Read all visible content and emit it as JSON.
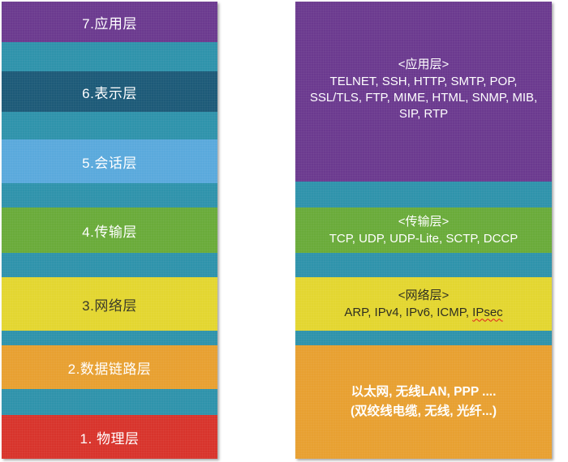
{
  "colors": {
    "teal": "#2f93ab",
    "purple": "#6b3a8f",
    "navy": "#1d5a78",
    "light_blue": "#5aa9dc",
    "green": "#6aab3a",
    "yellow": "#e3d630",
    "orange": "#e8a031",
    "red": "#d8342c"
  },
  "osi_layers": [
    {
      "label": "7.应用层",
      "color": "purple"
    },
    {
      "label": "6.表示层",
      "color": "navy"
    },
    {
      "label": "5.会话层",
      "color": "light_blue"
    },
    {
      "label": "4.传输层",
      "color": "green"
    },
    {
      "label": "3.网络层",
      "color": "yellow"
    },
    {
      "label": "2.数据链路层",
      "color": "orange"
    },
    {
      "label": "1. 物理层",
      "color": "red"
    }
  ],
  "tcpip": {
    "application": {
      "header": "<应用层>",
      "protocols": "TELNET, SSH, HTTP, SMTP, POP, SSL/TLS, FTP, MIME, HTML, SNMP, MIB, SIP, RTP"
    },
    "transport": {
      "header": "<传输层>",
      "protocols": "TCP, UDP, UDP-Lite, SCTP, DCCP"
    },
    "network": {
      "header": "<网络层>",
      "protocols": "ARP, IPv4, IPv6, ICMP, ",
      "protocols_last": "IPsec"
    },
    "link": {
      "line1": "以太网, 无线LAN, PPP ....",
      "line2": "(双绞线电缆, 无线, 光纤...)"
    }
  }
}
